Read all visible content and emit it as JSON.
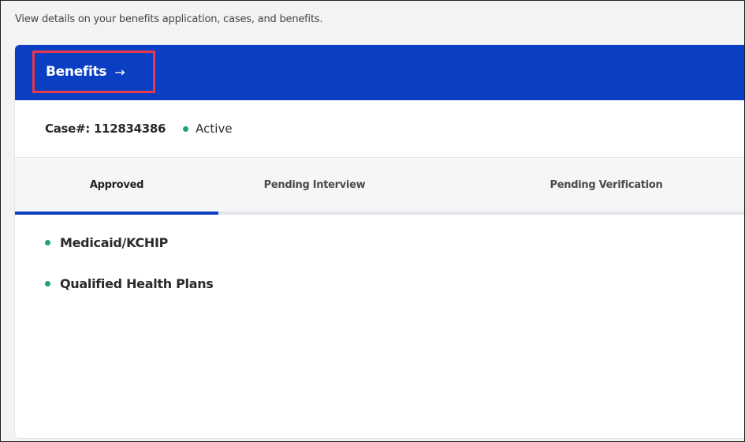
{
  "intro_text": "View details on your benefits application, cases, and benefits.",
  "header": {
    "title": "Benefits",
    "arrow": "→"
  },
  "case": {
    "number_label": "Case#: 112834386",
    "status": "Active"
  },
  "tabs": [
    {
      "label": "Approved",
      "active": true
    },
    {
      "label": "Pending Interview",
      "active": false
    },
    {
      "label": "Pending Verification",
      "active": false
    }
  ],
  "benefits": [
    {
      "label": "Medicaid/KCHIP"
    },
    {
      "label": "Qualified Health Plans"
    }
  ],
  "colors": {
    "header_bg": "#0a3fc4",
    "highlight_border": "#e63a4a",
    "status_dot": "#1ea66a",
    "active_tab_underline": "#0a3fc4"
  },
  "icons": {
    "header_arrow": "arrow-right-icon",
    "status_dot": "status-dot-icon",
    "bullet": "bullet-dot-icon"
  }
}
